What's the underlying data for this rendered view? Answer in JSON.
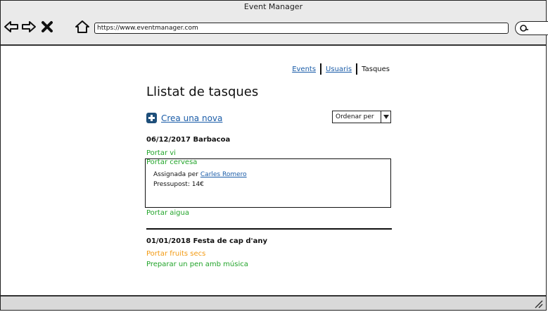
{
  "window": {
    "title": "Event Manager"
  },
  "browser": {
    "url": "https://www.eventmanager.com"
  },
  "nav": {
    "events": "Events",
    "users": "Usuaris",
    "tasks": "Tasques"
  },
  "page": {
    "title": "Llistat de tasques",
    "create_label": "Crea una nova",
    "sort_label": "Ordenar per"
  },
  "events": [
    {
      "title": "06/12/2017 Barbacoa",
      "tasks": [
        {
          "label": "Portar vi"
        },
        {
          "label": "Portar cervesa",
          "assigned_prefix": "Assignada per",
          "assigned_to": "Carles Romero",
          "budget": "Pressupost: 14€"
        },
        {
          "label": "Portar aigua"
        }
      ]
    },
    {
      "title": "01/01/2018 Festa de cap d'any",
      "tasks": [
        {
          "label": "Portar fruits secs"
        },
        {
          "label": "Preparar un pen amb música"
        }
      ]
    }
  ],
  "colors": {
    "link": "#1a5ca8",
    "task_done": "#22a42a",
    "task_pending": "#f39a12"
  }
}
